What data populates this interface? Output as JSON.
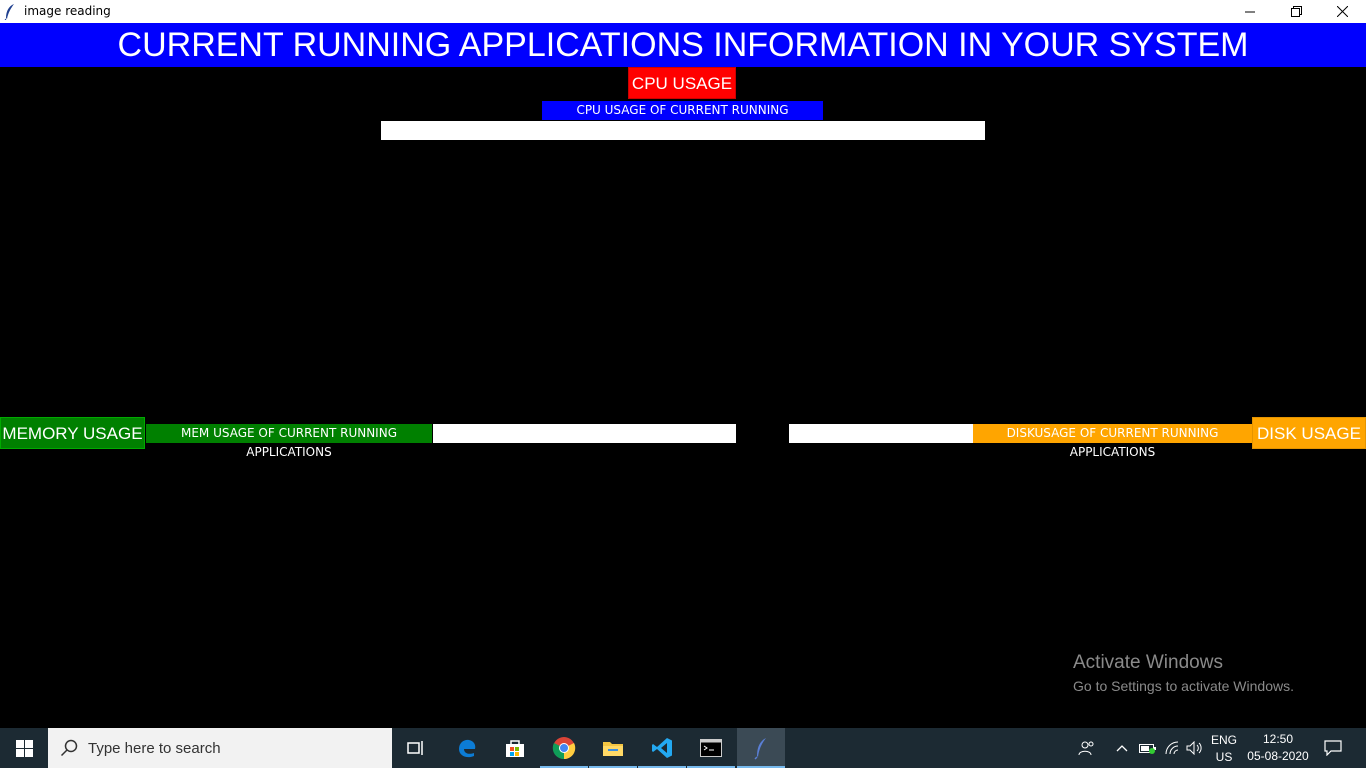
{
  "window": {
    "title": "image reading",
    "controls": [
      "minimize",
      "maximize",
      "close"
    ]
  },
  "header": {
    "banner": "CURRENT RUNNING APPLICATIONS INFORMATION IN YOUR SYSTEM"
  },
  "cpu": {
    "button_label": "CPU USAGE",
    "section_label": "CPU USAGE OF CURRENT RUNNING APPLICATIONS",
    "value": ""
  },
  "memory": {
    "button_label": "MEMORY USAGE",
    "section_label": "MEM USAGE OF CURRENT RUNNING APPLICATIONS",
    "value": ""
  },
  "disk": {
    "button_label": "DISK USAGE",
    "section_label": "DISKUSAGE OF CURRENT RUNNING APPLICATIONS",
    "value": ""
  },
  "watermark": {
    "line1": "Activate Windows",
    "line2": "Go to Settings to activate Windows."
  },
  "taskbar": {
    "search_placeholder": "Type here to search",
    "apps": [
      "task-view",
      "edge",
      "store",
      "chrome",
      "file-explorer",
      "vscode",
      "terminal",
      "tk-feather"
    ],
    "language_line1": "ENG",
    "language_line2": "US",
    "time": "12:50",
    "date": "05-08-2020"
  },
  "colors": {
    "banner_bg": "#0000ff",
    "cpu_button_bg": "#ff0000",
    "memory_bg": "#008000",
    "disk_bg": "#ffa500",
    "page_bg": "#000000"
  }
}
